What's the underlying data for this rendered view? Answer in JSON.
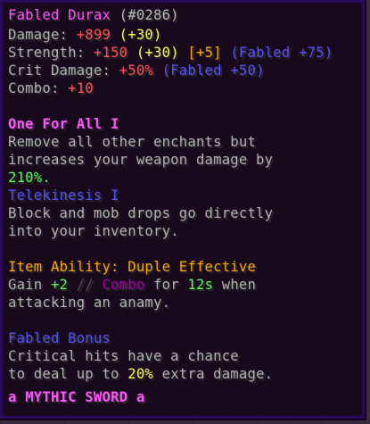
{
  "tooltip": {
    "title": {
      "name": "Fabled Durax",
      "id": "(#0286)"
    },
    "stats": [
      {
        "label": "Damage: ",
        "value": "+899",
        "bonus": "(+30)",
        "extra": "",
        "fabled": ""
      },
      {
        "label": "Strength: ",
        "value": "+150",
        "bonus": "(+30)",
        "extra": "[+5]",
        "fabled": "(Fabled +75)"
      },
      {
        "label": "Crit Damage: ",
        "value": "+50%",
        "bonus": "",
        "extra": "",
        "fabled": "(Fabled +50)"
      },
      {
        "label": "Combo: ",
        "value": "+10",
        "bonus": "",
        "extra": "",
        "fabled": ""
      }
    ],
    "enchant1": {
      "name": "One For All I",
      "desc1": "Remove all other enchants but",
      "desc2": "increases your weapon damage by",
      "desc3": "210%."
    },
    "enchant2": {
      "name": "Telekinesis I",
      "desc1": "Block and mob drops go directly",
      "desc2": "into your inventory."
    },
    "ability": {
      "name": "Item Ability: Duple Effective",
      "gain": "Gain ",
      "amount": "+2",
      "sep": " // ",
      "combo": "Combo",
      "for": " for ",
      "duration": "12s",
      "when": " when",
      "line2": "attacking an anamy."
    },
    "fabled": {
      "name": "Fabled Bonus",
      "line1": "Critical hits have a chance",
      "line2a": "to deal up to ",
      "pct": "20%",
      "line2b": " extra damage."
    },
    "rarity": {
      "prefix": "a",
      "text": "MYTHIC SWORD",
      "suffix": "a"
    }
  },
  "colors": {
    "red": "#ff5555",
    "yellow": "#ffff55",
    "gold": "#ffaa00",
    "blue": "#5555ff",
    "green": "#55ff55",
    "pink": "#ff55ff",
    "gray": "#aaaaaa",
    "purple": "#aa00aa"
  }
}
